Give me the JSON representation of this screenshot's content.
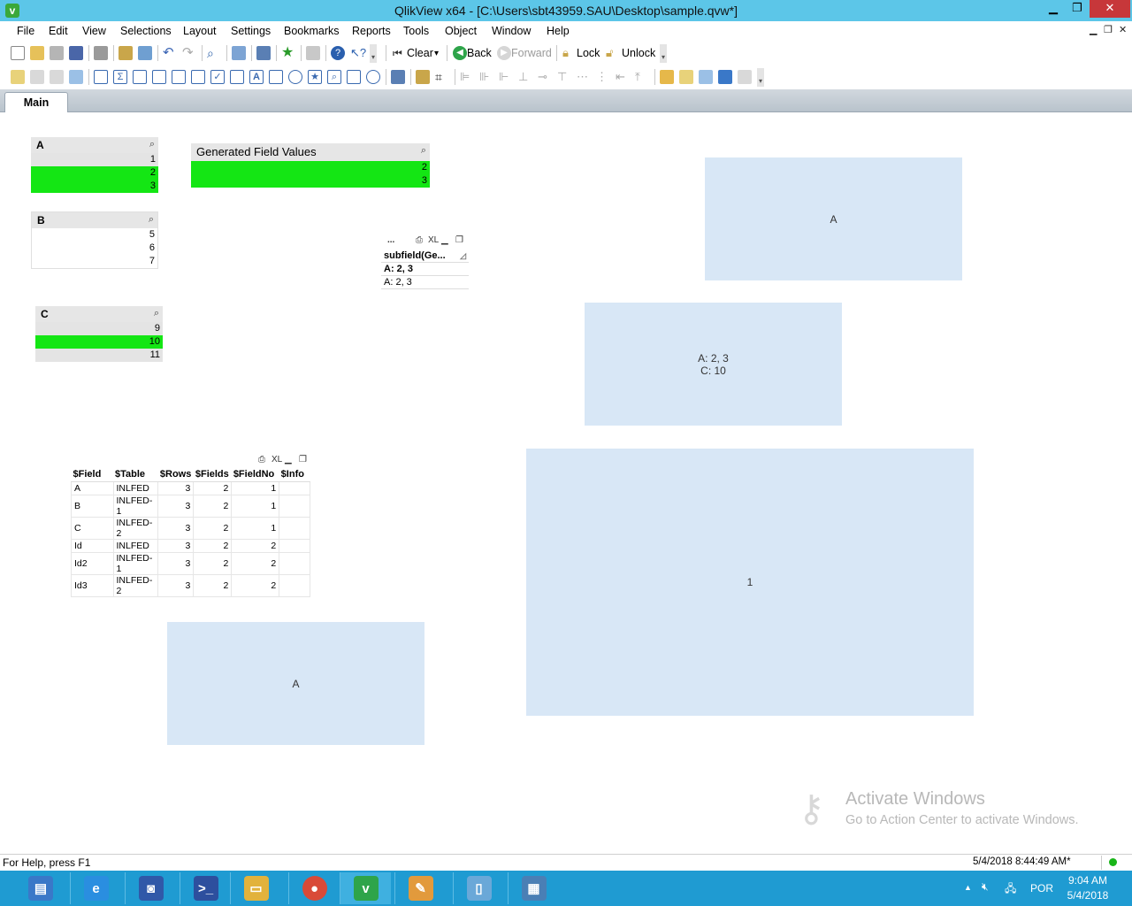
{
  "window": {
    "title": "QlikView x64 - [C:\\Users\\sbt43959.SAU\\Desktop\\sample.qvw*]",
    "app_icon_letter": "v",
    "minimize_glyph": "▁",
    "maximize_glyph": "❐",
    "close_glyph": "✕"
  },
  "menu": {
    "items": [
      "File",
      "Edit",
      "View",
      "Selections",
      "Layout",
      "Settings",
      "Bookmarks",
      "Reports",
      "Tools",
      "Object",
      "Window",
      "Help"
    ],
    "mdi_minimize": "▁",
    "mdi_restore": "❐",
    "mdi_close": "✕"
  },
  "toolbar": {
    "clear_label": "Clear",
    "back_label": "Back",
    "forward_label": "Forward",
    "lock_label": "Lock",
    "unlock_label": "Unlock",
    "dropdown_glyph": "▾"
  },
  "sheet_tabs": [
    "Main"
  ],
  "listboxes": {
    "a": {
      "title": "A",
      "rows": [
        {
          "value": "1",
          "state": "excluded"
        },
        {
          "value": "2",
          "state": "selected"
        },
        {
          "value": "3",
          "state": "selected"
        }
      ]
    },
    "b": {
      "title": "B",
      "rows": [
        {
          "value": "5",
          "state": "optional"
        },
        {
          "value": "6",
          "state": "optional"
        },
        {
          "value": "7",
          "state": "optional"
        }
      ]
    },
    "c": {
      "title": "C",
      "rows": [
        {
          "value": "9",
          "state": "excluded"
        },
        {
          "value": "10",
          "state": "selected"
        },
        {
          "value": "11",
          "state": "excluded"
        }
      ]
    },
    "generated": {
      "title": "Generated Field Values",
      "rows": [
        {
          "value": "2",
          "state": "selected"
        },
        {
          "value": "3",
          "state": "selected"
        }
      ]
    }
  },
  "search_glyph": "⌕",
  "subfield_table": {
    "menu_dots": "...",
    "xl_label": "XL",
    "header": "subfield(Ge...",
    "total": "A: 2, 3",
    "row": "A: 2, 3"
  },
  "system_table": {
    "xl_label": "XL",
    "columns": [
      "$Field",
      "$Table",
      "$Rows",
      "$Fields",
      "$FieldNo",
      "$Info"
    ],
    "rows": [
      [
        "A",
        "INLFED",
        "3",
        "2",
        "1",
        ""
      ],
      [
        "B",
        "INLFED-1",
        "3",
        "2",
        "1",
        ""
      ],
      [
        "C",
        "INLFED-2",
        "3",
        "2",
        "1",
        ""
      ],
      [
        "Id",
        "INLFED",
        "3",
        "2",
        "2",
        ""
      ],
      [
        "Id2",
        "INLFED-1",
        "3",
        "2",
        "2",
        ""
      ],
      [
        "Id3",
        "INLFED-2",
        "3",
        "2",
        "2",
        ""
      ]
    ]
  },
  "text_objects": {
    "top_right": "A",
    "middle_line1": "A: 2, 3",
    "middle_line2": "C: 10",
    "large": "1",
    "bottom_left": "A"
  },
  "watermark": {
    "line1": "Activate Windows",
    "line2": "Go to Action Center to activate Windows."
  },
  "status": {
    "help": "For Help, press F1",
    "timestamp": "5/4/2018 8:44:49 AM*"
  },
  "taskbar": {
    "language": "POR",
    "time": "9:04 AM",
    "date": "5/4/2018",
    "apps": [
      {
        "name": "server-manager",
        "glyph": "▤",
        "color": "#3a78c8"
      },
      {
        "name": "internet-explorer",
        "glyph": "e",
        "color": "#2a8ee0"
      },
      {
        "name": "remote-desktop",
        "glyph": "◙",
        "color": "#3058a8"
      },
      {
        "name": "powershell",
        "glyph": ">_",
        "color": "#2d4f9e"
      },
      {
        "name": "file-explorer",
        "glyph": "▭",
        "color": "#e2b23c"
      },
      {
        "name": "chrome",
        "glyph": "●",
        "color": "#d94a38"
      },
      {
        "name": "qlikview",
        "glyph": "v",
        "color": "#2ea44a"
      },
      {
        "name": "paint",
        "glyph": "✎",
        "color": "#e29a3c"
      },
      {
        "name": "notepad",
        "glyph": "▯",
        "color": "#6aa8d8"
      },
      {
        "name": "task-manager",
        "glyph": "▦",
        "color": "#4a7fb5"
      }
    ]
  },
  "colors": {
    "selected": "#14e614",
    "excluded": "#e4e4e4",
    "text_object_bg": "#d8e7f6",
    "titlebar": "#5cc6e8",
    "taskbar": "#1f9bd2"
  }
}
